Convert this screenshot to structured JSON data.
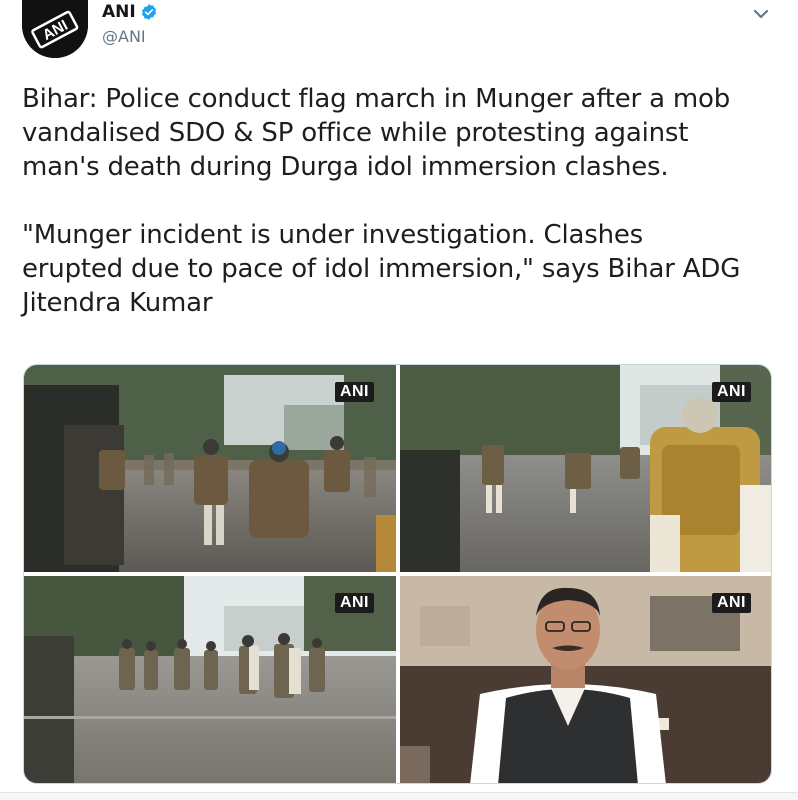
{
  "author": {
    "display_name": "ANI",
    "handle": "@ANI",
    "avatar_icon": "ani-logo-icon",
    "verified_icon": "verified-badge-icon",
    "avatar_text": "ANI"
  },
  "menu": {
    "icon": "chevron-down-icon"
  },
  "tweet": {
    "paragraph_1": "Bihar: Police conduct flag march in Munger after a mob\nvandalised SDO & SP office while protesting against\nman's death during Durga idol immersion clashes.",
    "paragraph_2": "\"Munger incident is under investigation. Clashes\nerupted due to pace of idol immersion,\" says Bihar ADG\nJitendra Kumar"
  },
  "media": [
    {
      "watermark": "ANI"
    },
    {
      "watermark": "ANI"
    },
    {
      "watermark": "ANI"
    },
    {
      "watermark": "ANI"
    }
  ],
  "colors": {
    "verified": "#1da1f2",
    "handle": "#657786",
    "watermark_bg": "#1b1b1b"
  }
}
